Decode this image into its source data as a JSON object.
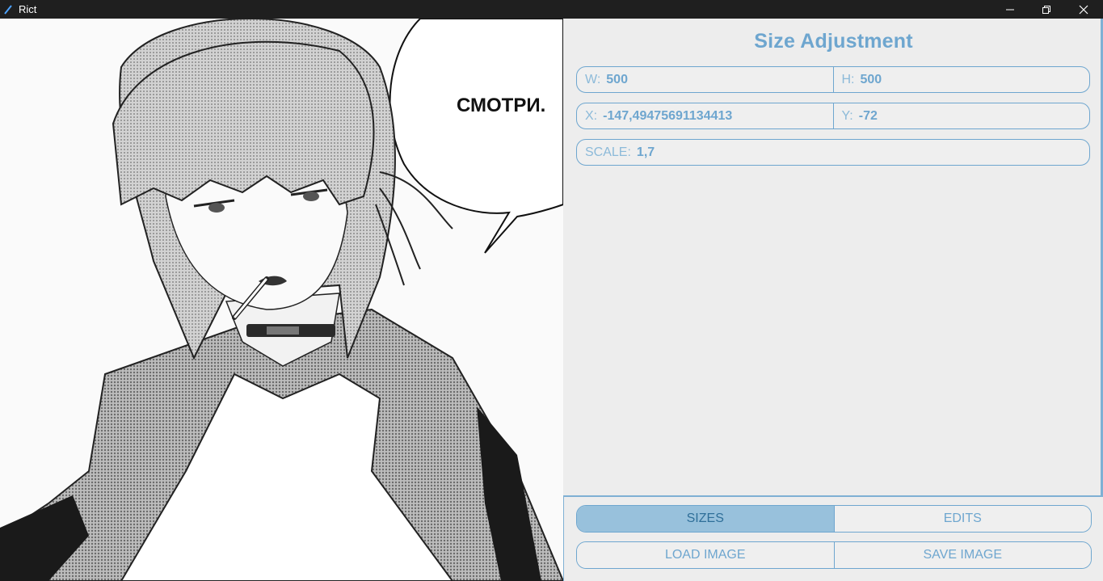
{
  "window": {
    "title": "Rict",
    "icon": "rict-app-icon",
    "controls": [
      "minimize-icon",
      "maximize-icon",
      "close-icon"
    ]
  },
  "canvas": {
    "speech_bubble_text": "СМОТРИ."
  },
  "panel": {
    "title": "Size Adjustment",
    "fields": {
      "w": {
        "label": "W:",
        "value": "500"
      },
      "h": {
        "label": "H:",
        "value": "500"
      },
      "x": {
        "label": "X:",
        "value": "-147,49475691134413"
      },
      "y": {
        "label": "Y:",
        "value": "-72"
      },
      "scale": {
        "label": "SCALE:",
        "value": "1,7"
      }
    }
  },
  "bottom": {
    "tabs": [
      {
        "label": "SIZES",
        "active": true
      },
      {
        "label": "EDITS",
        "active": false
      }
    ],
    "actions": {
      "load": "LOAD IMAGE",
      "save": "SAVE IMAGE"
    }
  },
  "colors": {
    "accent": "#6ea6cf",
    "accent_active_bg": "#98c1dc",
    "titlebar": "#1f1f1f",
    "panel_bg": "#ededed"
  }
}
